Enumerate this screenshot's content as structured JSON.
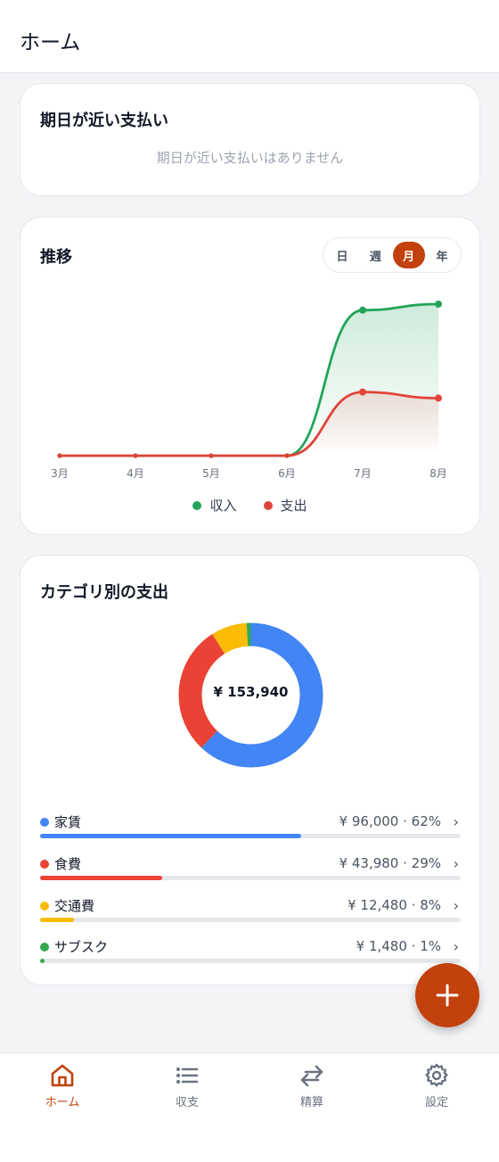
{
  "appbar": {
    "title": "ホーム"
  },
  "upcoming": {
    "title": "期日が近い支払い",
    "empty_text": "期日が近い支払いはありません"
  },
  "trend": {
    "title": "推移",
    "periods": [
      "日",
      "週",
      "月",
      "年"
    ],
    "active_period": "月",
    "legend": {
      "income": "収入",
      "expense": "支出"
    }
  },
  "category": {
    "title": "カテゴリ別の支出",
    "total": "¥ 153,940",
    "items": [
      {
        "name": "家賃",
        "amount": "¥ 96,000 · 62%",
        "color": "#4285f4",
        "percent": 62
      },
      {
        "name": "食費",
        "amount": "¥ 43,980 · 29%",
        "color": "#ea4335",
        "percent": 29
      },
      {
        "name": "交通費",
        "amount": "¥ 12,480 · 8%",
        "color": "#fbbc05",
        "percent": 8
      },
      {
        "name": "サブスク",
        "amount": "¥ 1,480 · 1%",
        "color": "#34a853",
        "percent": 1
      }
    ]
  },
  "nav": [
    {
      "label": "ホーム",
      "icon": "home-icon",
      "active": true
    },
    {
      "label": "収支",
      "icon": "list-icon",
      "active": false
    },
    {
      "label": "精算",
      "icon": "swap-arrows-icon",
      "active": false
    },
    {
      "label": "設定",
      "icon": "gear-icon",
      "active": false
    }
  ],
  "colors": {
    "accent": "#c2410c",
    "income": "#22a55a",
    "expense": "#e0443a"
  },
  "chart_data": {
    "type": "area",
    "categories": [
      "3月",
      "4月",
      "5月",
      "6月",
      "7月",
      "8月"
    ],
    "series": [
      {
        "name": "収入",
        "values": [
          0,
          0,
          0,
          0,
          96,
          100
        ]
      },
      {
        "name": "支出",
        "values": [
          0,
          0,
          0,
          0,
          42,
          38
        ]
      }
    ],
    "ylim": [
      0,
      100
    ],
    "grid": false,
    "legend": "bottom"
  }
}
